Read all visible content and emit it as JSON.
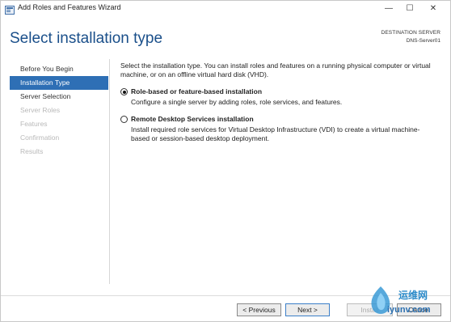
{
  "window": {
    "title": "Add Roles and Features Wizard",
    "controls": {
      "minimize": "—",
      "maximize": "☐",
      "close": "✕"
    }
  },
  "header": {
    "title": "Select installation type",
    "destination_label": "DESTINATION SERVER",
    "destination_server": "DNS-Server01"
  },
  "nav": {
    "items": [
      {
        "label": "Before You Begin",
        "state": "normal"
      },
      {
        "label": "Installation Type",
        "state": "active"
      },
      {
        "label": "Server Selection",
        "state": "normal"
      },
      {
        "label": "Server Roles",
        "state": "disabled"
      },
      {
        "label": "Features",
        "state": "disabled"
      },
      {
        "label": "Confirmation",
        "state": "disabled"
      },
      {
        "label": "Results",
        "state": "disabled"
      }
    ]
  },
  "content": {
    "intro": "Select the installation type. You can install roles and features on a running physical computer or virtual machine, or on an offline virtual hard disk (VHD).",
    "options": [
      {
        "title": "Role-based or feature-based installation",
        "description": "Configure a single server by adding roles, role services, and features.",
        "selected": true
      },
      {
        "title": "Remote Desktop Services installation",
        "description": "Install required role services for Virtual Desktop Infrastructure (VDI) to create a virtual machine-based or session-based desktop deployment.",
        "selected": false
      }
    ]
  },
  "footer": {
    "previous": "< Previous",
    "next": "Next >",
    "install": "Install",
    "cancel": "Cancel"
  },
  "watermark": {
    "cn": "运维网",
    "url": "iyunv.com"
  },
  "colors": {
    "accent": "#2e6fb5",
    "title": "#1a4f8a"
  }
}
